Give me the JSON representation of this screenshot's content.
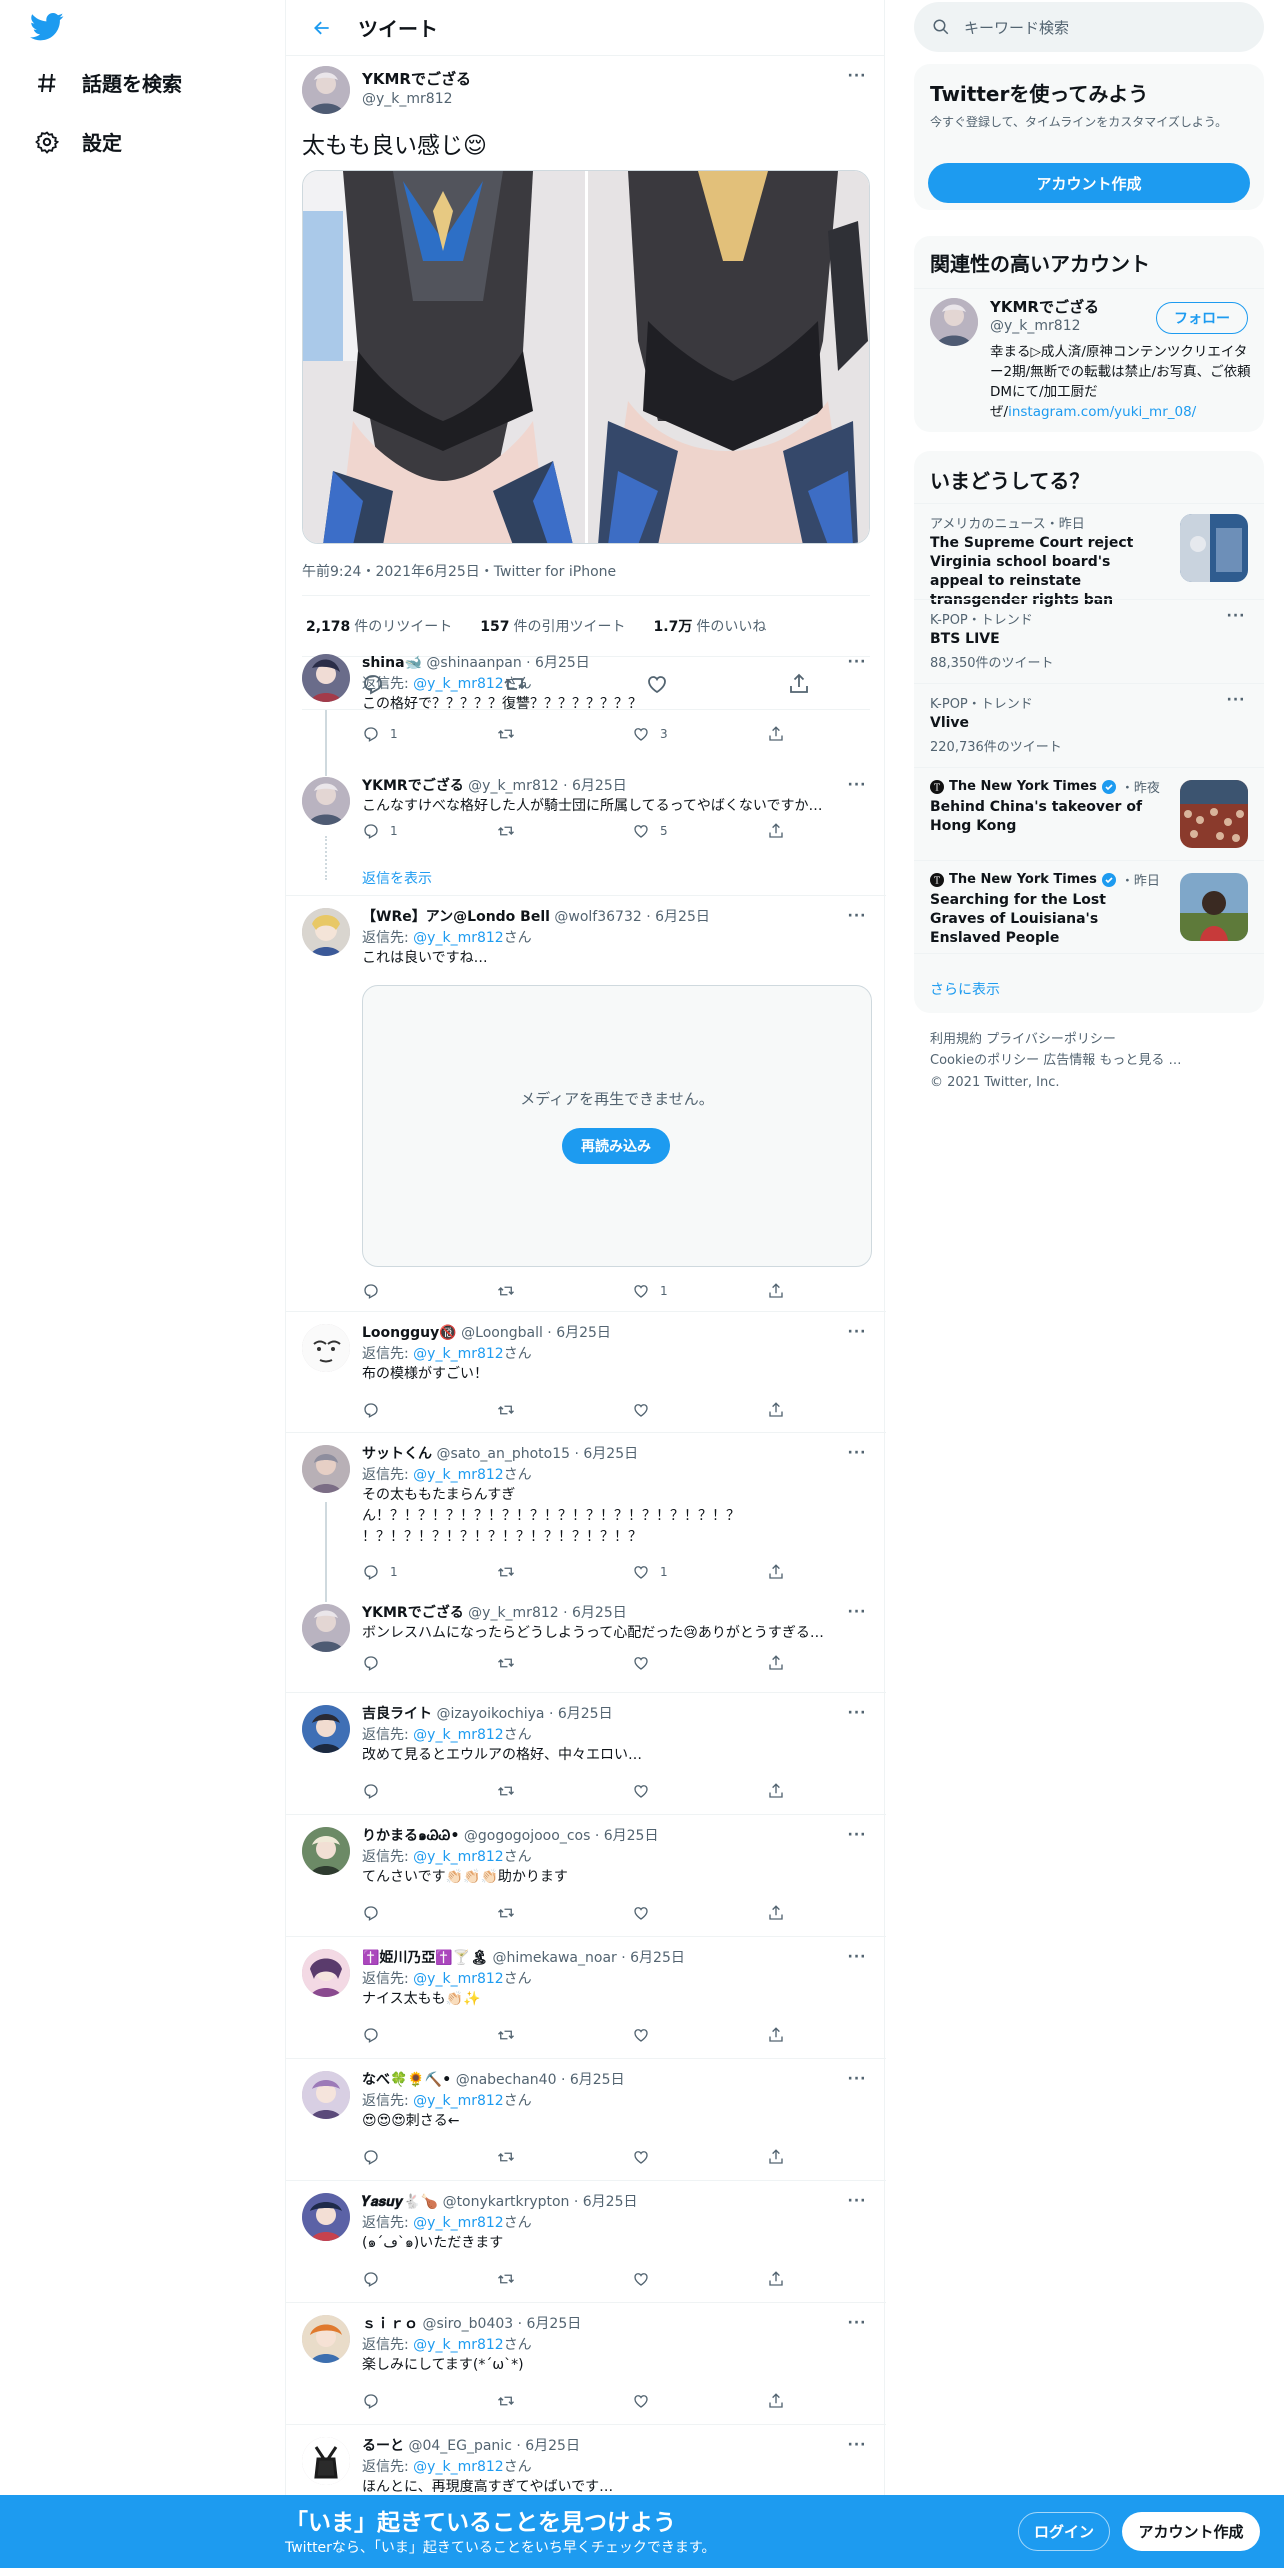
{
  "colors": {
    "accent": "#1d9bf0",
    "text": "#0f1419",
    "secondary": "#536471"
  },
  "nav": {
    "explore": "話題を検索",
    "settings": "設定"
  },
  "header": {
    "title": "ツイート"
  },
  "main_tweet": {
    "name": "YKMRでござる",
    "handle": "@y_k_mr812",
    "text": "太もも良い感じ😌",
    "meta": "午前9:24・2021年6月25日・Twitter for iPhone",
    "retweets_count": "2,178",
    "retweets_label": "件のリツイート",
    "quotes_count": "157",
    "quotes_label": "件の引用ツイート",
    "likes_count": "1.7万",
    "likes_label": "件のいいね"
  },
  "replies": [
    {
      "name": "shina🐋",
      "handle": "@shinaanpan · 6月25日",
      "reply_to_label": "返信先: ",
      "reply_to": "@y_k_mr812",
      "reply_suffix": "さん",
      "text": "この格好で？？？？？復讐？？？？？？？？",
      "reply_count": "1",
      "rt_count": "",
      "like_count": "3"
    },
    {
      "name": "YKMRでござる",
      "handle": "@y_k_mr812 · 6月25日",
      "text": "こんなすけべな格好した人が騎士団に所属してるってやばくないですか…",
      "reply_count": "1",
      "rt_count": "",
      "like_count": "5",
      "show_replies": "返信を表示"
    },
    {
      "name": "【WRe】アン@Londo Bell",
      "handle": "@wolf36732 · 6月25日",
      "reply_to_label": "返信先: ",
      "reply_to": "@y_k_mr812",
      "reply_suffix": "さん",
      "text": "これは良いですね…",
      "media_error": "メディアを再生できません。",
      "reload": "再読み込み",
      "reply_count": "",
      "rt_count": "",
      "like_count": "1"
    },
    {
      "name": "Loongguy🔞",
      "handle": "@Loongball · 6月25日",
      "reply_to_label": "返信先: ",
      "reply_to": "@y_k_mr812",
      "reply_suffix": "さん",
      "text": "布の模様がすごい！",
      "reply_count": "",
      "rt_count": "",
      "like_count": ""
    },
    {
      "name": "サットくん",
      "handle": "@sato_an_photo15 · 6月25日",
      "reply_to_label": "返信先: ",
      "reply_to": "@y_k_mr812",
      "reply_suffix": "さん",
      "text_line1": "その太ももたまらんすぎ",
      "text_line2": "ん！？！？！？！？！？！？！？！？！？！？！？！？！？",
      "text_line3": "！？！？！？！？！？！？！？！？！？！？",
      "reply_count": "1",
      "rt_count": "",
      "like_count": "1"
    },
    {
      "name": "YKMRでござる",
      "handle": "@y_k_mr812 · 6月25日",
      "text": "ボンレスハムになったらどうしようって心配だった😢ありがとうすぎる…",
      "reply_count": "",
      "rt_count": "",
      "like_count": ""
    },
    {
      "name": "吉良ライト",
      "handle": "@izayoikochiya · 6月25日",
      "reply_to_label": "返信先: ",
      "reply_to": "@y_k_mr812",
      "reply_suffix": "さん",
      "text": "改めて見るとエウルアの格好、中々エロい…",
      "reply_count": "",
      "rt_count": "",
      "like_count": ""
    },
    {
      "name": "りかまる๑ᏊᏊ•",
      "handle": "@gogogojooo_cos · 6月25日",
      "reply_to_label": "返信先: ",
      "reply_to": "@y_k_mr812",
      "reply_suffix": "さん",
      "text": "てんさいです👏🏻👏🏻👏🏻助かります",
      "reply_count": "",
      "rt_count": "",
      "like_count": ""
    },
    {
      "name": "✝️姫川乃亞✝️🍸🏝",
      "handle": "@himekawa_noar · 6月25日",
      "reply_to_label": "返信先: ",
      "reply_to": "@y_k_mr812",
      "reply_suffix": "さん",
      "text": "ナイス太もも👏🏻✨",
      "reply_count": "",
      "rt_count": "",
      "like_count": ""
    },
    {
      "name": "なべ🍀🌻⛏️•",
      "handle": "@nabechan40 · 6月25日",
      "reply_to_label": "返信先: ",
      "reply_to": "@y_k_mr812",
      "reply_suffix": "さん",
      "text": "😍😍😍刺さる←",
      "reply_count": "",
      "rt_count": "",
      "like_count": ""
    },
    {
      "name": "𝒀𝒂𝒔𝒖𝒚🐇🍗",
      "handle": "@tonykartkrypton · 6月25日",
      "reply_to_label": "返信先: ",
      "reply_to": "@y_k_mr812",
      "reply_suffix": "さん",
      "text": "(๑´ڡ`๑)いただきます",
      "reply_count": "",
      "rt_count": "",
      "like_count": ""
    },
    {
      "name": "ｓｉｒｏ",
      "handle": "@siro_b0403 · 6月25日",
      "reply_to_label": "返信先: ",
      "reply_to": "@y_k_mr812",
      "reply_suffix": "さん",
      "text": "楽しみにしてます(*´ω`*)",
      "reply_count": "",
      "rt_count": "",
      "like_count": ""
    },
    {
      "name": "るーと",
      "handle": "@04_EG_panic · 6月25日",
      "reply_to_label": "返信先: ",
      "reply_to": "@y_k_mr812",
      "reply_suffix": "さん",
      "text": "ほんとに、再現度高すぎてやばいです…"
    }
  ],
  "sidebar": {
    "search_placeholder": "キーワード検索",
    "signup_box": {
      "title": "Twitterを使ってみよう",
      "desc": "今すぐ登録して、タイムラインをカスタマイズしよう。",
      "button": "アカウント作成"
    },
    "related": {
      "title": "関連性の高いアカウント",
      "name": "YKMRでござる",
      "handle": "@y_k_mr812",
      "follow": "フォロー",
      "bio": "幸まる▷成人済/原神コンテンツクリエイター2期/無断での転載は禁止/お写真、ご依頼DMにて/加工厨だぜ/",
      "link": "instagram.com/yuki_mr_08/"
    },
    "trends": {
      "title": "いまどうしてる？",
      "items": [
        {
          "category": "アメリカのニュース・昨日",
          "name": "The Supreme Court reject Virginia school board's appeal to reinstate transgender rights ban"
        },
        {
          "category": "K-POP・トレンド",
          "name": "BTS LIVE",
          "count": "88,350件のツイート"
        },
        {
          "category": "K-POP・トレンド",
          "name": "Vlive",
          "count": "220,736件のツイート"
        },
        {
          "source": "The New York Times",
          "time": "・昨夜",
          "name": "Behind China's takeover of Hong Kong"
        },
        {
          "source": "The New York Times",
          "time": "・昨日",
          "name": "Searching for the Lost Graves of Louisiana's Enslaved People"
        }
      ],
      "more": "さらに表示"
    },
    "footer": {
      "line1": "利用規約 プライバシーポリシー",
      "line2": "Cookieのポリシー 広告情報 もっと見る …",
      "line3": "© 2021 Twitter, Inc."
    }
  },
  "bottom_bar": {
    "headline": "「いま」起きていることを見つけよう",
    "sub": "Twitterなら、「いま」起きていることをいち早くチェックできます。",
    "login": "ログイン",
    "signup": "アカウント作成"
  }
}
